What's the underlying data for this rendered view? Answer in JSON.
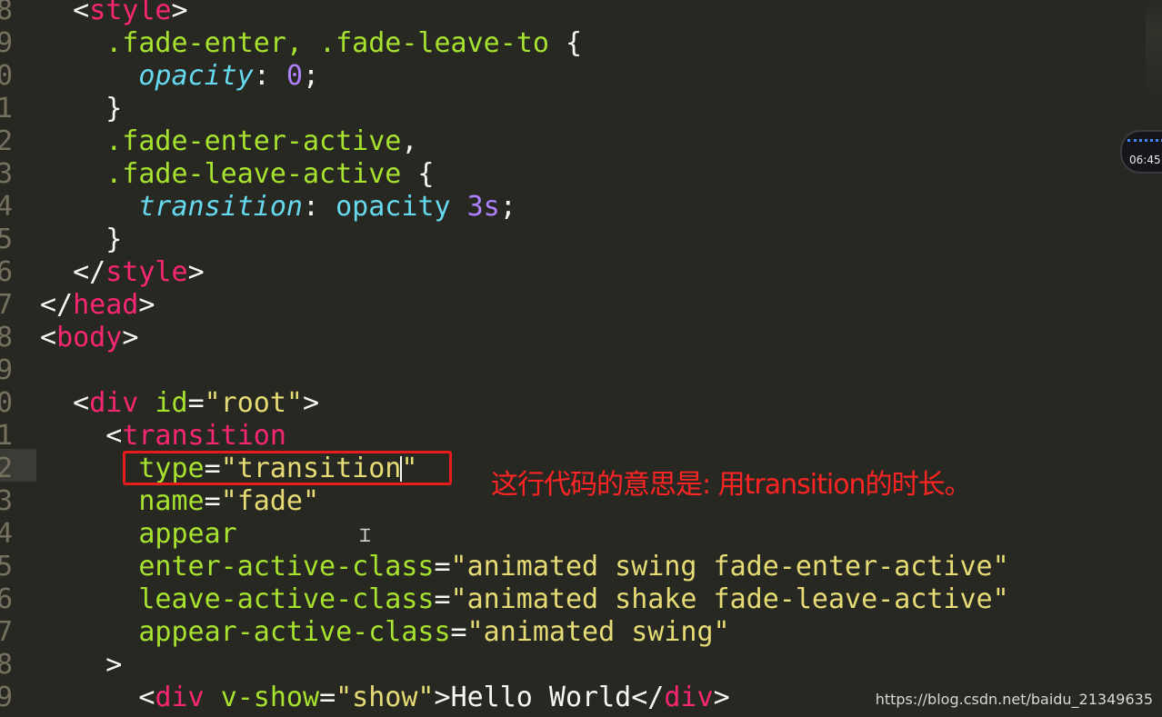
{
  "editor": {
    "lines": [
      {
        "num": "8",
        "tokens": [
          {
            "t": "  ",
            "c": "tk-punc"
          },
          {
            "t": "<",
            "c": "tk-punc"
          },
          {
            "t": "style",
            "c": "tk-tag"
          },
          {
            "t": ">",
            "c": "tk-punc"
          }
        ]
      },
      {
        "num": "9",
        "tokens": [
          {
            "t": "    ",
            "c": "tk-punc"
          },
          {
            "t": ".fade-enter, .fade-leave-to ",
            "c": "tk-sel"
          },
          {
            "t": "{",
            "c": "tk-punc"
          }
        ]
      },
      {
        "num": "0",
        "tokens": [
          {
            "t": "      ",
            "c": "tk-punc"
          },
          {
            "t": "opacity",
            "c": "tk-prop"
          },
          {
            "t": ": ",
            "c": "tk-punc"
          },
          {
            "t": "0",
            "c": "tk-num"
          },
          {
            "t": ";",
            "c": "tk-punc"
          }
        ]
      },
      {
        "num": "1",
        "tokens": [
          {
            "t": "    ",
            "c": "tk-punc"
          },
          {
            "t": "}",
            "c": "tk-punc"
          }
        ]
      },
      {
        "num": "2",
        "tokens": [
          {
            "t": "    ",
            "c": "tk-punc"
          },
          {
            "t": ".fade-enter-active",
            "c": "tk-sel"
          },
          {
            "t": ",",
            "c": "tk-punc"
          }
        ]
      },
      {
        "num": "3",
        "tokens": [
          {
            "t": "    ",
            "c": "tk-punc"
          },
          {
            "t": ".fade-leave-active ",
            "c": "tk-sel"
          },
          {
            "t": "{",
            "c": "tk-punc"
          }
        ]
      },
      {
        "num": "4",
        "tokens": [
          {
            "t": "      ",
            "c": "tk-punc"
          },
          {
            "t": "transition",
            "c": "tk-prop"
          },
          {
            "t": ": ",
            "c": "tk-punc"
          },
          {
            "t": "opacity ",
            "c": "tk-val"
          },
          {
            "t": "3s",
            "c": "tk-num"
          },
          {
            "t": ";",
            "c": "tk-punc"
          }
        ]
      },
      {
        "num": "5",
        "tokens": [
          {
            "t": "    ",
            "c": "tk-punc"
          },
          {
            "t": "}",
            "c": "tk-punc"
          }
        ]
      },
      {
        "num": "6",
        "tokens": [
          {
            "t": "  ",
            "c": "tk-punc"
          },
          {
            "t": "</",
            "c": "tk-punc"
          },
          {
            "t": "style",
            "c": "tk-tag"
          },
          {
            "t": ">",
            "c": "tk-punc"
          }
        ]
      },
      {
        "num": "7",
        "tokens": [
          {
            "t": "</",
            "c": "tk-punc"
          },
          {
            "t": "head",
            "c": "tk-tag"
          },
          {
            "t": ">",
            "c": "tk-punc"
          }
        ]
      },
      {
        "num": "8",
        "tokens": [
          {
            "t": "<",
            "c": "tk-punc"
          },
          {
            "t": "body",
            "c": "tk-tag"
          },
          {
            "t": ">",
            "c": "tk-punc"
          }
        ]
      },
      {
        "num": "9",
        "tokens": []
      },
      {
        "num": "0",
        "tokens": [
          {
            "t": "  ",
            "c": "tk-punc"
          },
          {
            "t": "<",
            "c": "tk-punc"
          },
          {
            "t": "div",
            "c": "tk-tag"
          },
          {
            "t": " ",
            "c": "tk-punc"
          },
          {
            "t": "id",
            "c": "tk-attr"
          },
          {
            "t": "=",
            "c": "tk-punc"
          },
          {
            "t": "\"root\"",
            "c": "tk-str"
          },
          {
            "t": ">",
            "c": "tk-punc"
          }
        ]
      },
      {
        "num": "1",
        "tokens": [
          {
            "t": "    ",
            "c": "tk-punc"
          },
          {
            "t": "<",
            "c": "tk-punc"
          },
          {
            "t": "transition",
            "c": "tk-tag"
          }
        ]
      },
      {
        "num": "2",
        "tokens": [
          {
            "t": "      ",
            "c": "tk-punc"
          },
          {
            "t": "type",
            "c": "tk-attr"
          },
          {
            "t": "=",
            "c": "tk-punc"
          },
          {
            "t": "\"transition",
            "c": "tk-str"
          },
          {
            "t": "|",
            "c": "caret"
          },
          {
            "t": "\"",
            "c": "tk-str"
          }
        ]
      },
      {
        "num": "3",
        "tokens": [
          {
            "t": "      ",
            "c": "tk-punc"
          },
          {
            "t": "name",
            "c": "tk-attr"
          },
          {
            "t": "=",
            "c": "tk-punc"
          },
          {
            "t": "\"fade\"",
            "c": "tk-str"
          }
        ]
      },
      {
        "num": "4",
        "tokens": [
          {
            "t": "      ",
            "c": "tk-punc"
          },
          {
            "t": "appear",
            "c": "tk-attr"
          }
        ]
      },
      {
        "num": "5",
        "tokens": [
          {
            "t": "      ",
            "c": "tk-punc"
          },
          {
            "t": "enter-active-class",
            "c": "tk-attr"
          },
          {
            "t": "=",
            "c": "tk-punc"
          },
          {
            "t": "\"animated swing fade-enter-active\"",
            "c": "tk-str"
          }
        ]
      },
      {
        "num": "6",
        "tokens": [
          {
            "t": "      ",
            "c": "tk-punc"
          },
          {
            "t": "leave-active-class",
            "c": "tk-attr"
          },
          {
            "t": "=",
            "c": "tk-punc"
          },
          {
            "t": "\"animated shake fade-leave-active\"",
            "c": "tk-str"
          }
        ]
      },
      {
        "num": "7",
        "tokens": [
          {
            "t": "      ",
            "c": "tk-punc"
          },
          {
            "t": "appear-active-class",
            "c": "tk-attr"
          },
          {
            "t": "=",
            "c": "tk-punc"
          },
          {
            "t": "\"animated swing\"",
            "c": "tk-str"
          }
        ]
      },
      {
        "num": "8",
        "tokens": [
          {
            "t": "    ",
            "c": "tk-punc"
          },
          {
            "t": ">",
            "c": "tk-punc"
          }
        ]
      },
      {
        "num": "9",
        "tokens": [
          {
            "t": "      ",
            "c": "tk-punc"
          },
          {
            "t": "<",
            "c": "tk-punc"
          },
          {
            "t": "div",
            "c": "tk-tag"
          },
          {
            "t": " ",
            "c": "tk-punc"
          },
          {
            "t": "v-show",
            "c": "tk-attr"
          },
          {
            "t": "=",
            "c": "tk-punc"
          },
          {
            "t": "\"show\"",
            "c": "tk-str"
          },
          {
            "t": ">",
            "c": "tk-punc"
          },
          {
            "t": "Hello World",
            "c": "tk-text"
          },
          {
            "t": "</",
            "c": "tk-punc"
          },
          {
            "t": "div",
            "c": "tk-tag"
          },
          {
            "t": ">",
            "c": "tk-punc"
          }
        ]
      }
    ],
    "active_line_index": 14
  },
  "annotation": {
    "text": "这行代码的意思是: 用transition的时长。",
    "color": "#ff2424"
  },
  "recording": {
    "time": "06:45"
  },
  "watermark": {
    "text": "https://blog.csdn.net/baidu_21349635"
  },
  "colors": {
    "background": "#272822",
    "tag": "#f92672",
    "attribute": "#a6e22e",
    "string": "#e6db74",
    "property": "#66d9ef",
    "number": "#ae81ff",
    "highlight_box": "#e81c1c"
  }
}
